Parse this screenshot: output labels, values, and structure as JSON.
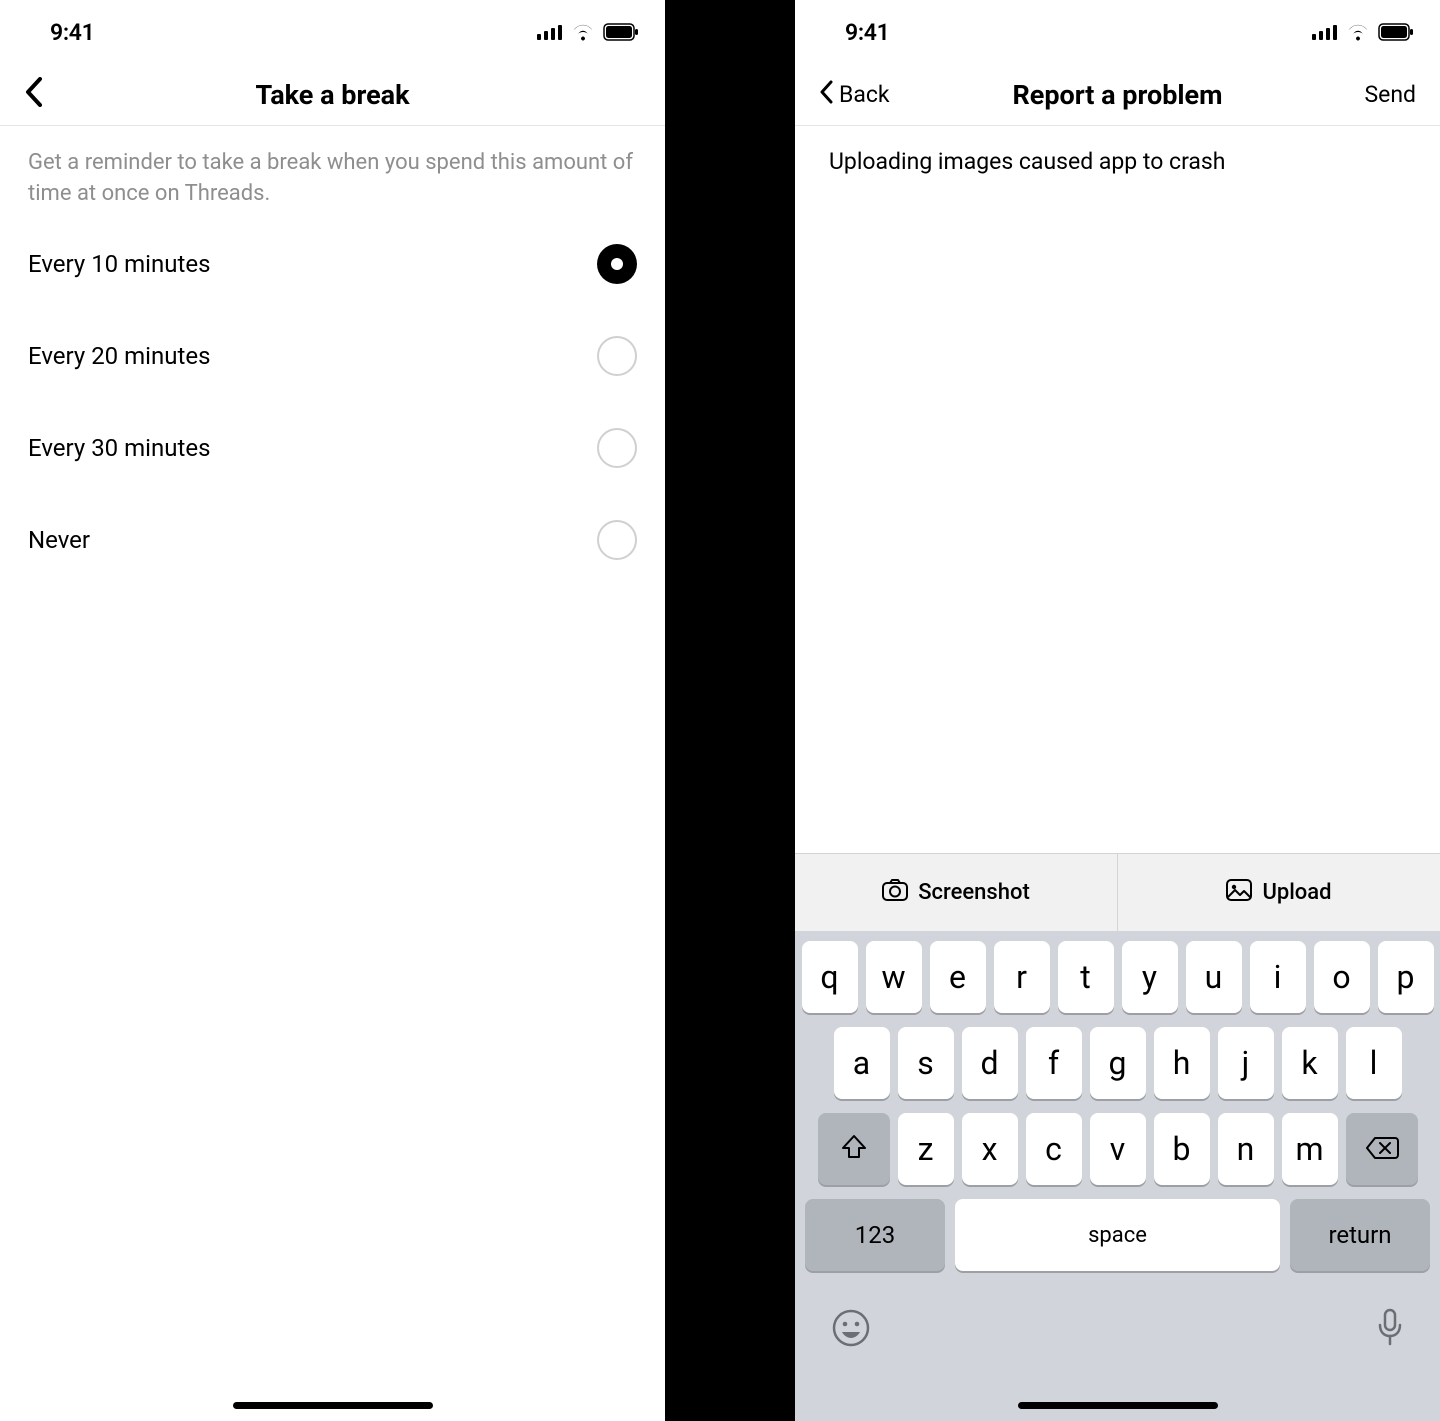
{
  "status_bar": {
    "time": "9:41"
  },
  "screen_left": {
    "title": "Take a break",
    "description": "Get a reminder to take a break when you spend this amount of time at once on Threads.",
    "options": [
      {
        "label": "Every 10 minutes",
        "selected": true
      },
      {
        "label": "Every 20 minutes",
        "selected": false
      },
      {
        "label": "Every 30 minutes",
        "selected": false
      },
      {
        "label": "Never",
        "selected": false
      }
    ]
  },
  "screen_right": {
    "back_label": "Back",
    "title": "Report a problem",
    "send_label": "Send",
    "body_text": "Uploading images caused app to crash",
    "attach": {
      "screenshot_label": "Screenshot",
      "upload_label": "Upload"
    },
    "keyboard": {
      "row1": [
        "q",
        "w",
        "e",
        "r",
        "t",
        "y",
        "u",
        "i",
        "o",
        "p"
      ],
      "row2": [
        "a",
        "s",
        "d",
        "f",
        "g",
        "h",
        "j",
        "k",
        "l"
      ],
      "row3": [
        "z",
        "x",
        "c",
        "v",
        "b",
        "n",
        "m"
      ],
      "numeric_label": "123",
      "space_label": "space",
      "return_label": "return"
    }
  }
}
